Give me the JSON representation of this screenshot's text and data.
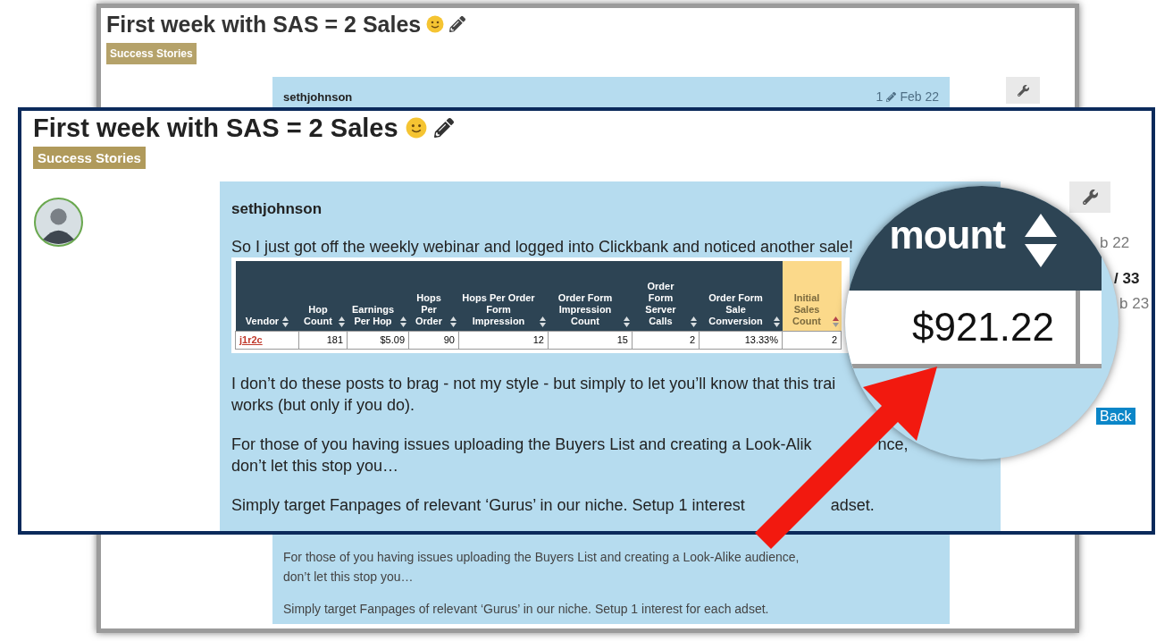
{
  "background_view": {
    "title": "First week with SAS = 2 Sales",
    "tag": "Success Stories",
    "author": "sethjohnson",
    "edit_count": "1",
    "date": "Feb 22",
    "paragraphs": [
      [
        "For those of you having issues uploading the Buyers List and creating a Look-Alike audience,",
        "don’t let this stop you…"
      ],
      [
        "Simply target Fanpages of relevant ‘Gurus’ in our niche. Setup 1 interest for each adset."
      ]
    ]
  },
  "topic": {
    "title": "First week with SAS = 2 Sales",
    "tag": "Success Stories"
  },
  "post": {
    "author": "sethjohnson",
    "intro": "So I just got off the weekly webinar and logged into Clickbank and noticed another sale!",
    "paragraphs": [
      {
        "lines": [
          [
            "I don’t do these posts to brag - not my style - but simply to let you’ll know that this trai"
          ],
          [
            "works (but only if you do)."
          ]
        ]
      },
      {
        "lines": [
          [
            "For those of you having issues uploading the Buyers List and creating a Look-Alik",
            "nce,"
          ],
          [
            "don’t let this stop you…"
          ]
        ]
      },
      {
        "lines": [
          [
            "Simply target Fanpages of relevant ‘Gurus’ in our niche. Setup 1 interest",
            "adset."
          ]
        ]
      }
    ]
  },
  "table": {
    "columns": [
      {
        "label": "Vendor",
        "sorted": false
      },
      {
        "label": "Hop Count",
        "sorted": false
      },
      {
        "label": "Earnings Per Hop",
        "sorted": false
      },
      {
        "label": "Hops Per Order",
        "sorted": false
      },
      {
        "label": "Hops Per Order Form Impression",
        "sorted": false
      },
      {
        "label": "Order Form Impression Count",
        "sorted": false
      },
      {
        "label": "Order Form Server Calls",
        "sorted": false
      },
      {
        "label": "Order Form Sale Conversion",
        "sorted": false
      },
      {
        "label": "Initial Sales Count",
        "sorted": true
      }
    ],
    "rows": [
      [
        "j1r2c",
        "181",
        "$5.09",
        "90",
        "12",
        "15",
        "2",
        "13.33%",
        "2"
      ]
    ]
  },
  "timeline": {
    "date_top": "b 22",
    "position": "/ 33",
    "date_bottom": "b 23",
    "back": "Back"
  },
  "magnifier": {
    "column": "mount",
    "value": "$921.22"
  }
}
